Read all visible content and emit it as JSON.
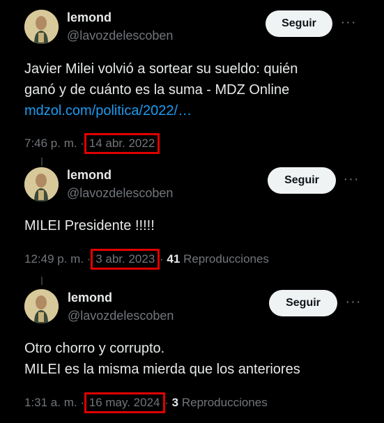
{
  "colors": {
    "background": "#000000",
    "text": "#e7e9ea",
    "secondary": "#71767b",
    "link": "#1d9bf0",
    "highlight_box": "#e00000",
    "button_bg": "#eff3f4"
  },
  "tweets": [
    {
      "name": "lemond",
      "handle": "@lavozdelescoben",
      "follow_label": "Seguir",
      "more_icon": "more-horizontal-icon",
      "text_lines": [
        "Javier Milei volvió a sortear su sueldo: quién",
        "ganó y de cuánto es la suma - MDZ Online"
      ],
      "link": "mdzol.com/politica/2022/…",
      "time": "7:46 p. m.",
      "separator": "·",
      "date": "14 abr. 2022"
    },
    {
      "name": "lemond",
      "handle": "@lavozdelescoben",
      "follow_label": "Seguir",
      "more_icon": "more-horizontal-icon",
      "text_lines": [
        "MILEI Presidente !!!!!"
      ],
      "time": "12:49 p. m.",
      "separator": "·",
      "date": "3 abr. 2023",
      "views_count": "41",
      "views_label": "Reproducciones"
    },
    {
      "name": "lemond",
      "handle": "@lavozdelescoben",
      "follow_label": "Seguir",
      "more_icon": "more-horizontal-icon",
      "text_lines": [
        "Otro chorro y corrupto.",
        "MILEI es la misma mierda que los anteriores"
      ],
      "time": "1:31 a. m.",
      "separator": "·",
      "date": "16 may. 2024",
      "views_count": "3",
      "views_label": "Reproducciones"
    }
  ]
}
